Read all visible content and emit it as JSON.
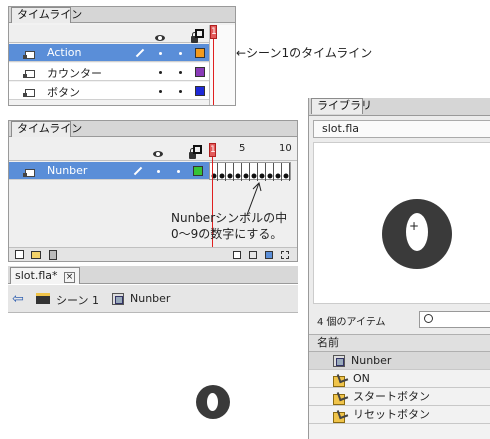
{
  "panel1": {
    "tab": "タイムライン",
    "header_icons": [
      "eye-icon",
      "lock-icon",
      "outline-icon"
    ],
    "playhead_frame": "1",
    "layers": [
      {
        "name": "Action",
        "selected": true,
        "color": "#f39a1c",
        "pencil": true
      },
      {
        "name": "カウンター",
        "selected": false,
        "color": "#8a3bb8",
        "pencil": false
      },
      {
        "name": "ボタン",
        "selected": false,
        "color": "#1f2ad8",
        "pencil": false
      }
    ],
    "annotation": "←シーン1のタイムライン"
  },
  "panel2": {
    "tab": "タイムライン",
    "frame_numbers": [
      "1",
      "5",
      "10"
    ],
    "layer": {
      "name": "Nunber",
      "selected": true,
      "color": "#36c336"
    },
    "annotation_line1": "Nunberシンボルの中",
    "annotation_line2": "0〜9の数字にする。",
    "doc_tab": "slot.fla*",
    "doc_tab_close": "×",
    "breadcrumb": {
      "scene": "シーン 1",
      "symbol": "Nunber"
    }
  },
  "library": {
    "tab": "ライブラリ",
    "file": "slot.fla",
    "preview_digit": "0",
    "item_count": "4 個のアイテム",
    "column_header": "名前",
    "items": [
      {
        "name": "Nunber",
        "icon": "movieclip-icon"
      },
      {
        "name": "ON",
        "icon": "button-icon"
      },
      {
        "name": "スタートボタン",
        "icon": "button-icon"
      },
      {
        "name": "リセットボタン",
        "icon": "button-icon"
      }
    ]
  },
  "stage": {
    "digit": "0"
  },
  "colors": {
    "selection": "#5a8ed8",
    "playhead": "#e02020",
    "digit_fill": "#3a3a3a"
  }
}
